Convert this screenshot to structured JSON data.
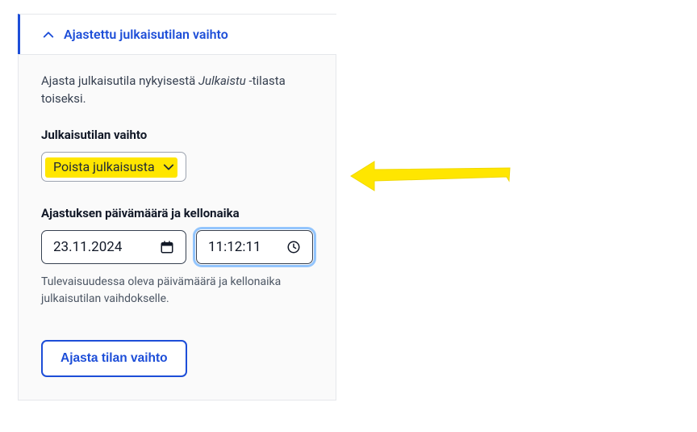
{
  "panel": {
    "title": "Ajastettu julkaisutilan vaihto",
    "description_prefix": "Ajasta julkaisutila nykyisestä ",
    "description_em": "Julkaistu",
    "description_suffix": " -tilasta toiseksi."
  },
  "state_change": {
    "label": "Julkaisutilan vaihto",
    "selected": "Poista julkaisusta"
  },
  "schedule": {
    "label": "Ajastuksen päivämäärä ja kellonaika",
    "date": "23.11.2024",
    "time": "11:12:11",
    "help": "Tulevaisuudessa oleva päivämäärä ja kellonaika julkaisutilan vaihdokselle."
  },
  "action": {
    "submit": "Ajasta tilan vaihto"
  },
  "colors": {
    "primary": "#1d4ed8",
    "highlight": "#ffe600"
  }
}
